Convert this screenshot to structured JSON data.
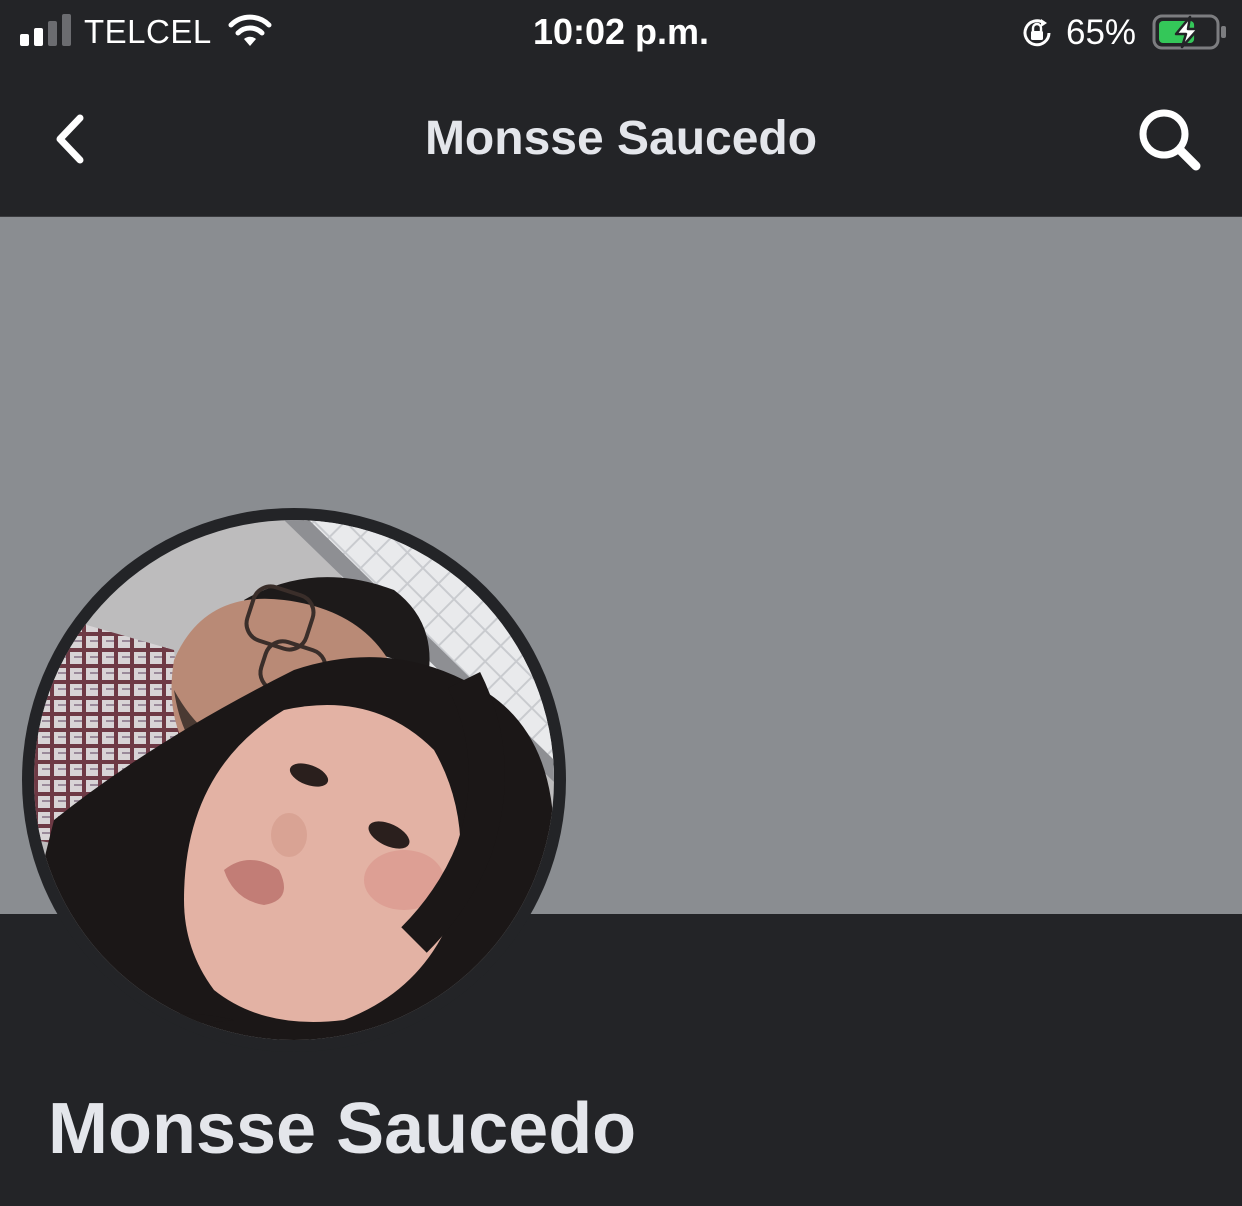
{
  "status_bar": {
    "carrier": "TELCEL",
    "time": "10:02 p.m.",
    "battery_percent": "65%",
    "battery_level": 0.65,
    "charging": true,
    "icons": [
      "signal-icon",
      "wifi-icon",
      "rotation-lock-icon",
      "battery-charging-icon"
    ],
    "battery_color": "#34c759"
  },
  "nav": {
    "title": "Monsse Saucedo",
    "back_icon": "chevron-left-icon",
    "search_icon": "search-icon"
  },
  "profile": {
    "name": "Monsse Saucedo"
  },
  "colors": {
    "background": "#232427",
    "cover": "#8a8d91",
    "text": "#e4e6eb"
  }
}
